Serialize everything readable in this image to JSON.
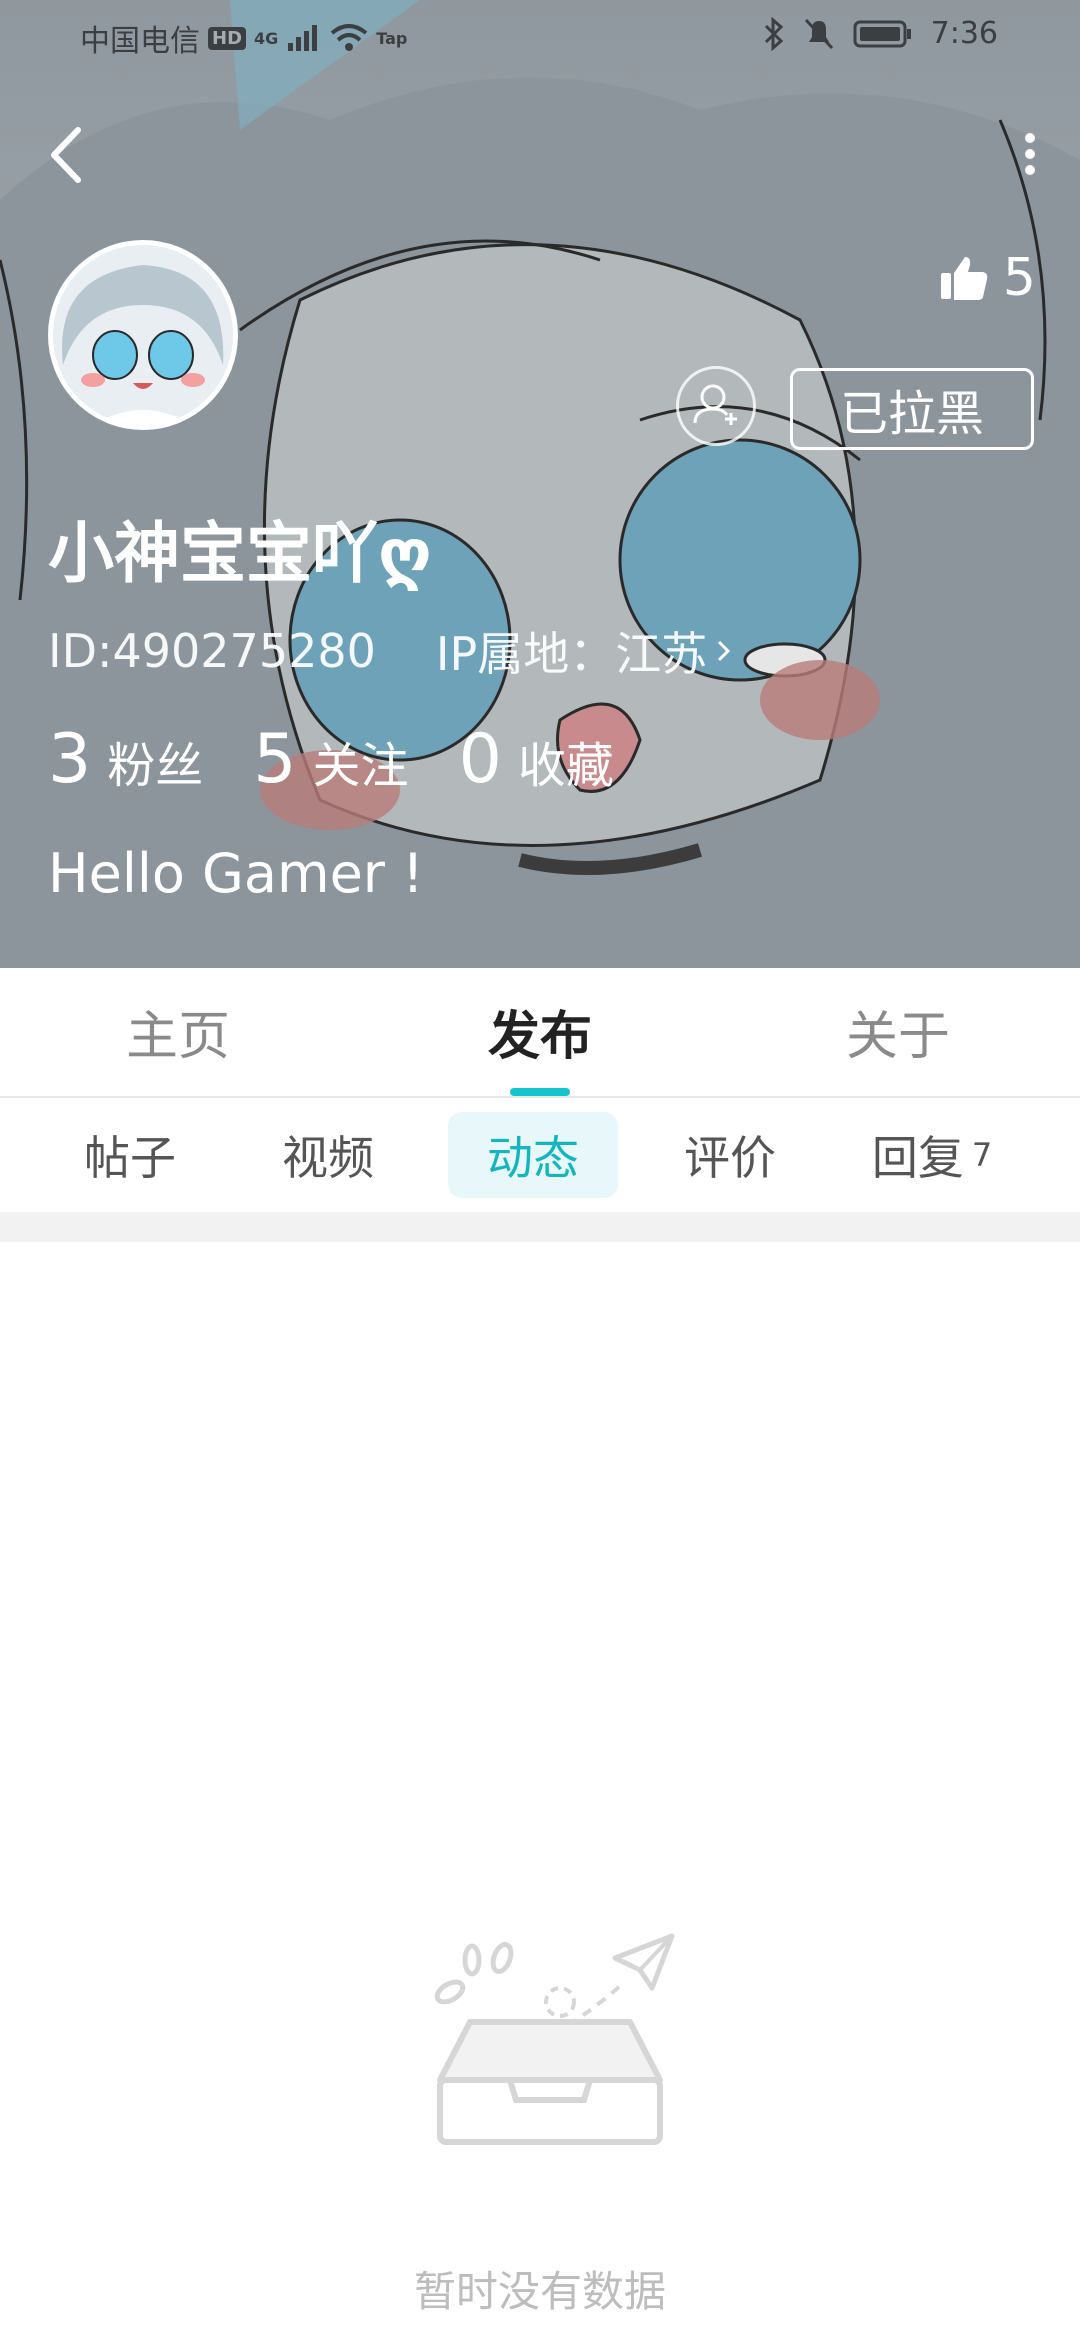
{
  "status_bar": {
    "carrier": "中国电信",
    "hd_badge": "HD",
    "network": "4G",
    "tap_label": "Tap",
    "time": "7:36"
  },
  "header": {
    "likes": "5",
    "block_button": "已拉黑"
  },
  "profile": {
    "name": "小神宝宝吖ღ",
    "id_text": "ID:490275280",
    "ip_text": "IP属地：江苏",
    "stats": [
      {
        "num": "3",
        "label": "粉丝"
      },
      {
        "num": "5",
        "label": "关注"
      },
      {
        "num": "0",
        "label": "收藏"
      }
    ],
    "bio": "Hello Gamer !"
  },
  "main_tabs": [
    "主页",
    "发布",
    "关于"
  ],
  "sub_tabs": {
    "posts": "帖子",
    "videos": "视频",
    "moments": "动态",
    "reviews": "评价",
    "replies": "回复",
    "replies_count": "7"
  },
  "empty_state": {
    "text": "暂时没有数据"
  },
  "colors": {
    "accent": "#15c5ce",
    "hero_bg": "#9ea7ad"
  }
}
